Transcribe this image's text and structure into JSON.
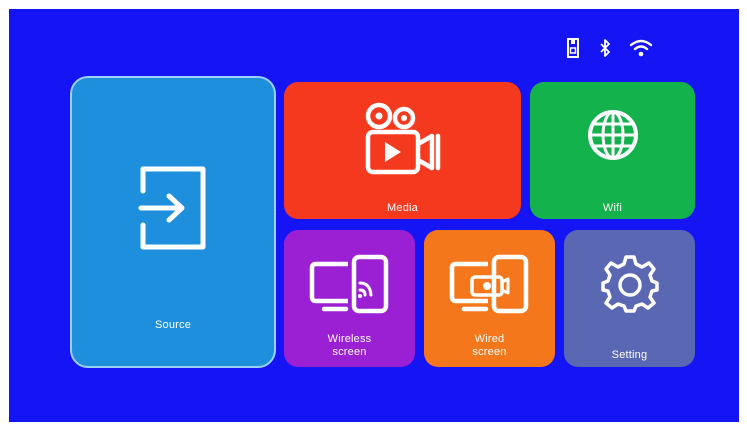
{
  "status_bar": {
    "icons": [
      "usb-storage-icon",
      "bluetooth-icon",
      "wifi-signal-icon"
    ]
  },
  "tiles": {
    "source": {
      "label": "Source",
      "icon": "input-source-icon",
      "color": "#1d8fdc"
    },
    "media": {
      "label": "Media",
      "icon": "video-camera-icon",
      "color": "#f4391f"
    },
    "wifi": {
      "label": "Wifi",
      "icon": "globe-icon",
      "color": "#13b24c"
    },
    "wireless_screen": {
      "label_line1": "Wireless",
      "label_line2": "screen",
      "icon": "screen-cast-icon",
      "color": "#9b20d3"
    },
    "wired_screen": {
      "label_line1": "Wired",
      "label_line2": "screen",
      "icon": "screen-mirror-icon",
      "color": "#f5771c"
    },
    "setting": {
      "label": "Setting",
      "icon": "gear-icon",
      "color": "#5a68b3"
    }
  },
  "background_color": "#1414f5"
}
